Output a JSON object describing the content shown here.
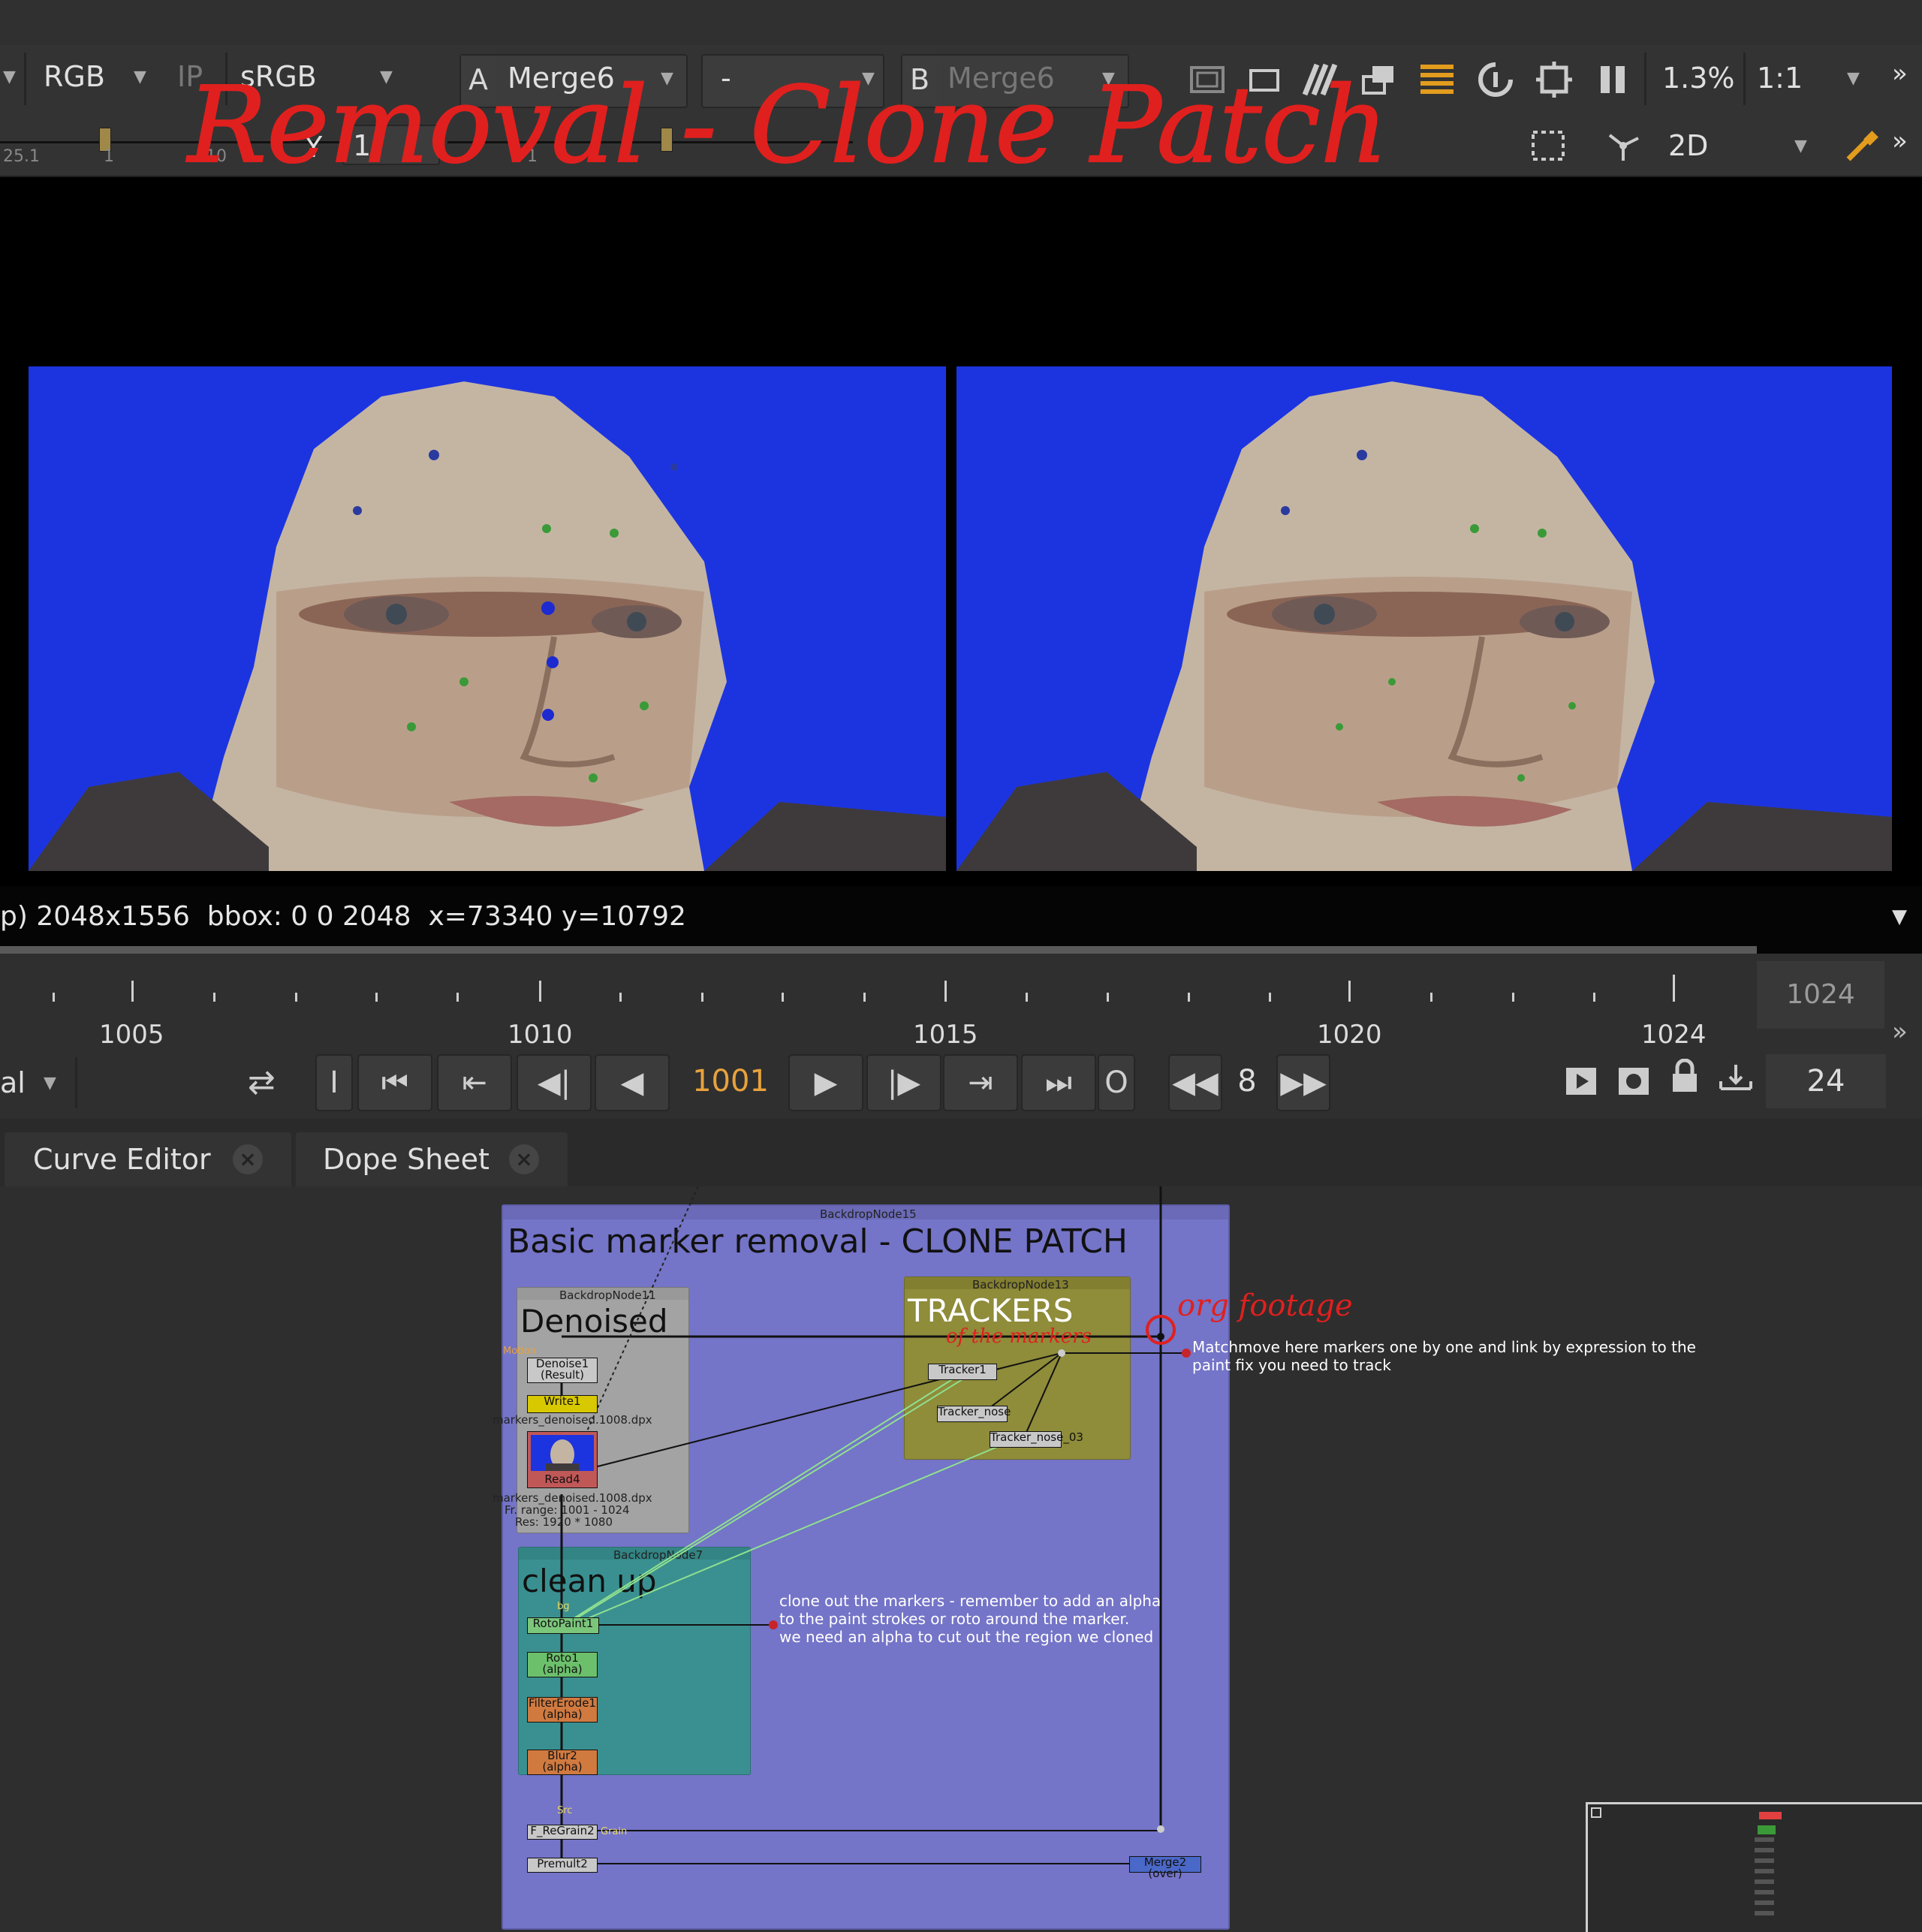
{
  "handwriting": {
    "title": "Removal - Clone Patch",
    "note1": "org footage",
    "note2": "of the markers"
  },
  "viewer_toolbar": {
    "channels": "RGB",
    "ip": "IP",
    "lut": "sRGB",
    "a_letter": "A",
    "a_input": "Merge6",
    "mode": "-",
    "b_letter": "B",
    "b_input": "Merge6",
    "zoom": "1.3%",
    "ratio": "1:1",
    "y_label": "Y",
    "y_value": "1",
    "gain_left": "25.1",
    "gain_tick1": "1",
    "gain_tick2": "10",
    "gain_tick3": "1",
    "view_mode": "2D"
  },
  "viewer": {
    "info": "p) 2048x1556  bbox: 0 0 2048  x=73340 y=10792"
  },
  "timeline": {
    "ticks": [
      "1005",
      "1010",
      "1015",
      "1020",
      "1024"
    ],
    "end_frame": "1024",
    "current_frame": "1001",
    "step": "8",
    "fps": "24",
    "mode_dropdown": "al",
    "in_btn": "I",
    "out_btn": "O"
  },
  "tabs": [
    {
      "label": "Curve Editor"
    },
    {
      "label": "Dope Sheet"
    }
  ],
  "nodegraph": {
    "backdrop_main_label": "BackdropNode15",
    "backdrop_main_title": "Basic marker removal - CLONE PATCH",
    "backdrop_denoise_label": "BackdropNode11",
    "backdrop_denoise_title": "Denoised",
    "backdrop_trackers_label": "BackdropNode13",
    "backdrop_trackers_title": "TRACKERS",
    "backdrop_cleanup_label": "BackdropNode7",
    "backdrop_cleanup_title": "clean up",
    "nodes": {
      "denoise": "Denoise1\n(Result)",
      "write": "Write1",
      "write_file": "markers_denoised.1008.dpx",
      "read": "Read4",
      "read_file": "markers_denoised.1008.dpx",
      "read_range": "Fr. range: 1001 - 1024",
      "read_res": "Res: 1920 * 1080",
      "tracker1": "Tracker1",
      "tracker_nose": "Tracker_nose",
      "tracker_nose03": "Tracker_nose_03",
      "rotopaint": "RotoPaint1",
      "roto": "Roto1\n(alpha)",
      "filtererode": "FilterErode1\n(alpha)",
      "blur": "Blur2\n(alpha)",
      "regrain": "F_ReGrain2",
      "premult": "Premult2",
      "merge": "Merge2 (over)",
      "motion_label": "Motion",
      "src_label": "Src",
      "grain_label": "Grain",
      "bg_label": "bg"
    },
    "note_trackers": "Matchmove here markers one by one and link by expression to the\npaint fix you need to track",
    "note_cleanup": "clone out the markers - remember to add an alpha\nto the paint strokes or roto around the marker.\nwe need an alpha to cut out the region we cloned"
  }
}
